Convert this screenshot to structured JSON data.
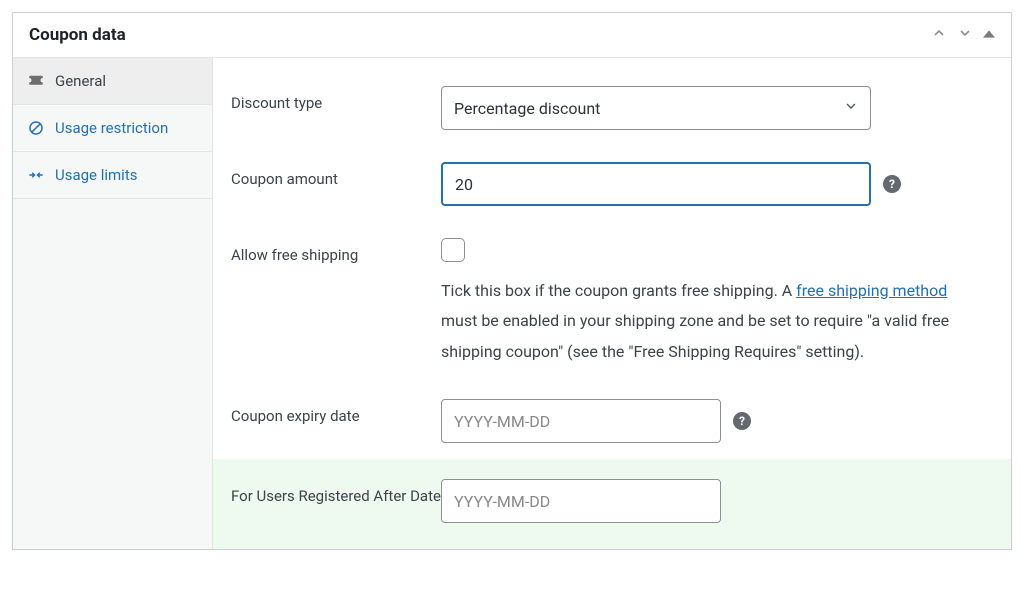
{
  "panel": {
    "title": "Coupon data"
  },
  "tabs": {
    "general": "General",
    "usage_restriction": "Usage restriction",
    "usage_limits": "Usage limits"
  },
  "fields": {
    "discount_type": {
      "label": "Discount type",
      "value": "Percentage discount"
    },
    "coupon_amount": {
      "label": "Coupon amount",
      "value": "20"
    },
    "allow_free_shipping": {
      "label": "Allow free shipping",
      "desc_prefix": "Tick this box if the coupon grants free shipping. A ",
      "desc_link": "free shipping method",
      "desc_suffix": " must be enabled in your shipping zone and be set to require \"a valid free shipping coupon\" (see the \"Free Shipping Requires\" setting)."
    },
    "coupon_expiry": {
      "label": "Coupon expiry date",
      "placeholder": "YYYY-MM-DD"
    },
    "registered_after": {
      "label": "For Users Registered After Date",
      "placeholder": "YYYY-MM-DD"
    }
  }
}
